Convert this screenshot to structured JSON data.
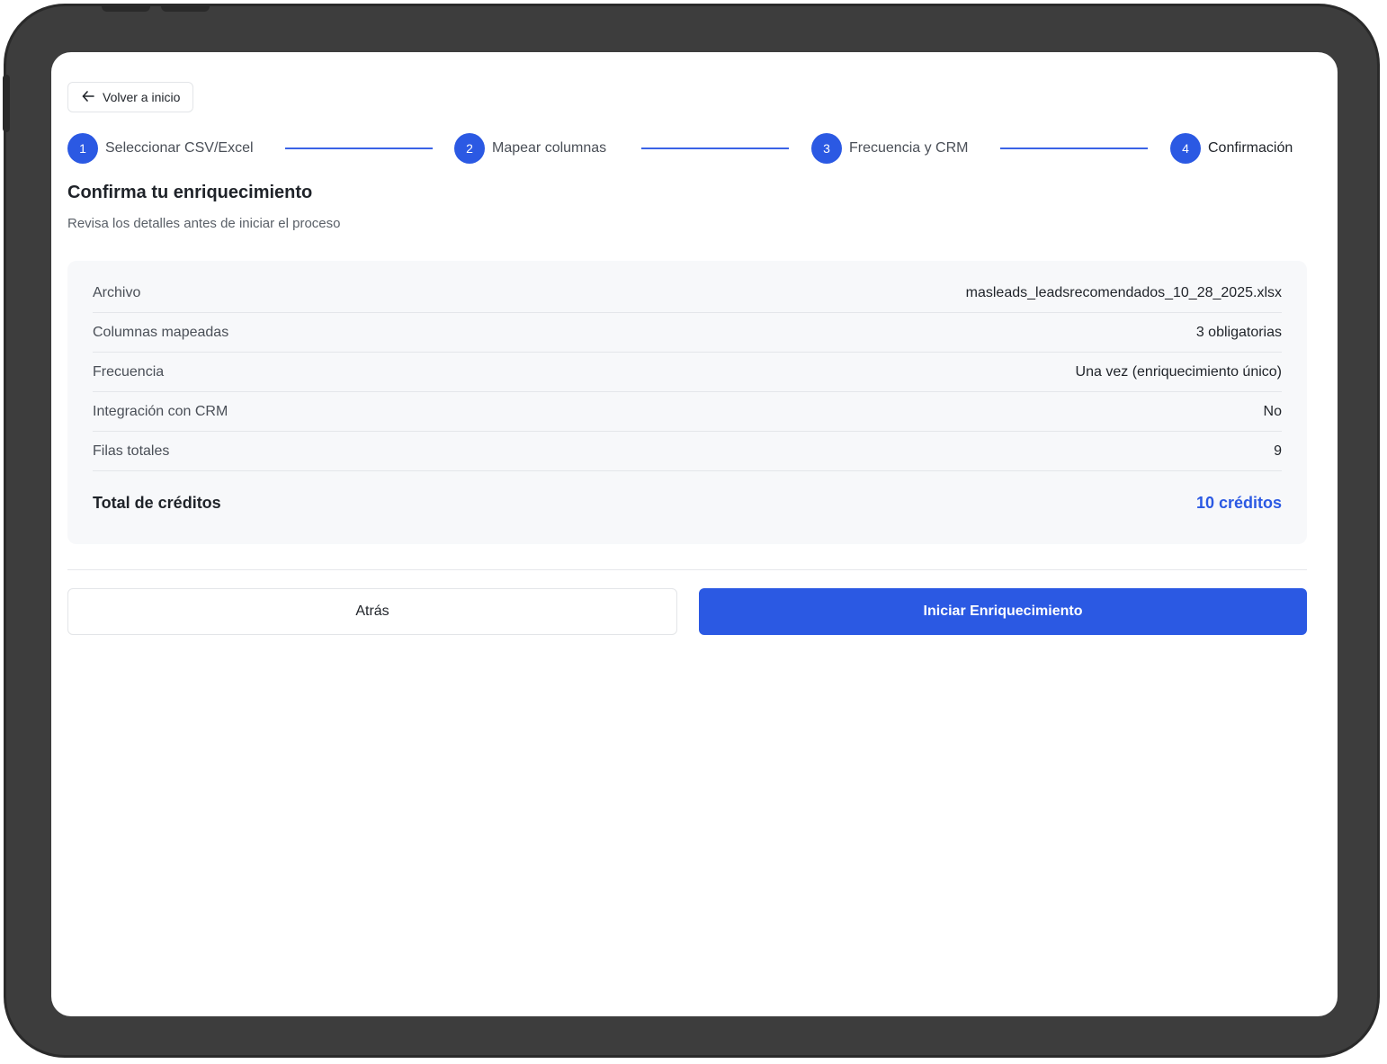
{
  "nav": {
    "back_label": "Volver a inicio",
    "back_icon": "arrow-left-icon"
  },
  "stepper": {
    "steps": [
      {
        "number": "1",
        "label": "Seleccionar CSV/Excel"
      },
      {
        "number": "2",
        "label": "Mapear columnas"
      },
      {
        "number": "3",
        "label": "Frecuencia y CRM"
      },
      {
        "number": "4",
        "label": "Confirmación"
      }
    ],
    "current_step": 4
  },
  "header": {
    "title": "Confirma tu enriquecimiento",
    "subtitle": "Revisa los detalles antes de iniciar el proceso"
  },
  "summary": {
    "rows": [
      {
        "label": "Archivo",
        "value": "masleads_leadsrecomendados_10_28_2025.xlsx"
      },
      {
        "label": "Columnas mapeadas",
        "value": "3 obligatorias"
      },
      {
        "label": "Frecuencia",
        "value": "Una vez (enriquecimiento único)"
      },
      {
        "label": "Integración con CRM",
        "value": "No"
      },
      {
        "label": "Filas totales",
        "value": "9"
      }
    ],
    "total": {
      "label": "Total de créditos",
      "value": "10 créditos"
    }
  },
  "actions": {
    "back_label": "Atrás",
    "start_label": "Iniciar Enriquecimiento"
  },
  "colors": {
    "accent": "#2b59e3",
    "device_frame": "#3d3d3d"
  }
}
